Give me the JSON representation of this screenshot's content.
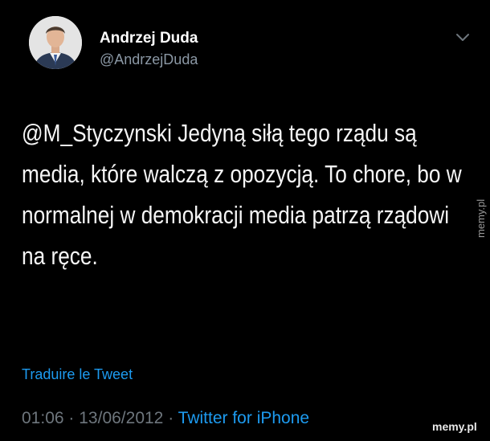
{
  "author": {
    "name": "Andrzej Duda",
    "handle": "@AndrzejDuda"
  },
  "tweet": {
    "text": "@M_Styczynski Jedyną siłą tego rządu są media, które walczą z opozycją. To chore, bo w normalnej w demokracji media patrzą rządowi na ręce."
  },
  "translate_label": "Traduire le Tweet",
  "meta": {
    "time": "01:06",
    "separator": "·",
    "date": "13/06/2012",
    "source": "Twitter for iPhone"
  },
  "watermark": "memy.pl",
  "icons": {
    "menu": "chevron-down-icon"
  },
  "colors": {
    "background": "#000000",
    "text": "#f5f5f5",
    "secondary": "#8b98a5",
    "link": "#1d9bf0"
  }
}
